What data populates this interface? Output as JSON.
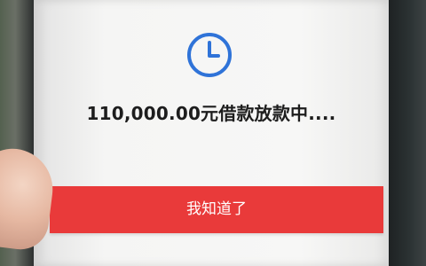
{
  "screen": {
    "status_text": "110,000.00元借款放款中....",
    "icon": "clock-icon",
    "icon_color": "#2f73d8",
    "button_label": "我知道了",
    "button_color": "#e93a3a"
  }
}
